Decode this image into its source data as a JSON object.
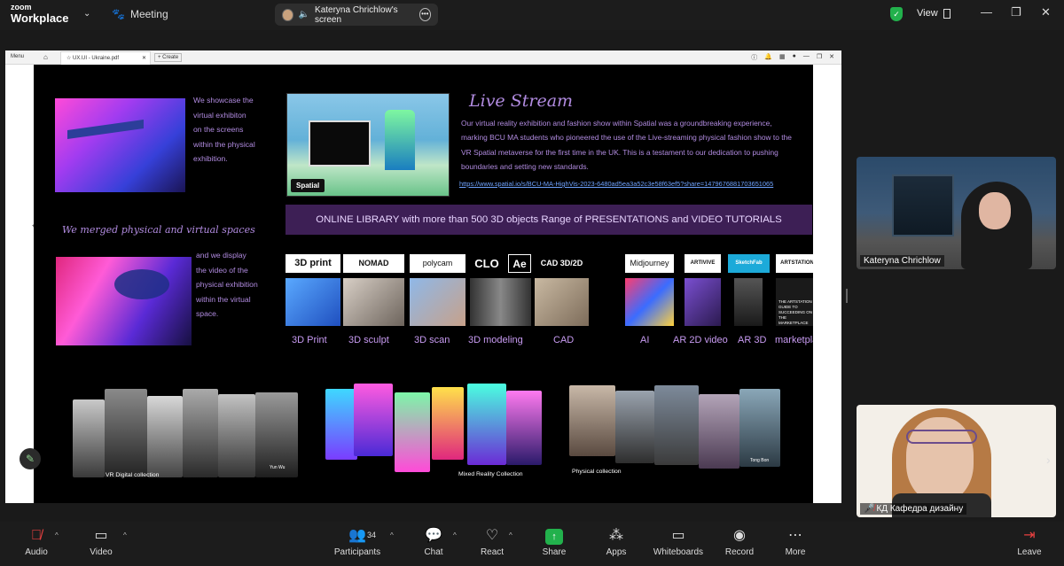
{
  "app": {
    "brand_top": "zoom",
    "brand_name": "Workplace",
    "meeting_label": "Meeting",
    "view_label": "View",
    "window_controls": [
      "—",
      "❐",
      "✕"
    ]
  },
  "screen_share": {
    "label": "Kateryna Chrichlow's screen"
  },
  "pdf_viewer": {
    "menu_label": "Menu",
    "tab_title": "UX.UI - Ukraine.pdf",
    "create_label": "+ Create"
  },
  "slide": {
    "showcase_text": "We showcase the virtual exhibiton on the screens within the physical exhibition.",
    "merged_title": "We merged physical and virtual spaces",
    "merged_text": "and we display the video of the physical exhibition within the virtual space.",
    "live_title": "Live Stream",
    "spatial_badge": "Spatial",
    "live_text": "Our virtual reality exhibition and fashion show within Spatial was a groundbreaking experience, marking BCU MA students who pioneered the use of the Live-streaming physical fashion show to the VR Spatial metaverse for the first time in the UK. This is a testament to our dedication to pushing boundaries and setting new standards.",
    "live_link": "https://www.spatial.io/s/BCU-MA-HighVis-2023-6480ad5ea3a52c3e58f63ef5?share=1479676881703651065",
    "library_banner": "ONLINE LIBRARY with more than 500 3D objects Range of PRESENTATIONS and VIDEO TUTORIALS",
    "logos": [
      "3D print",
      "NOMAD",
      "polycam",
      "CLO",
      "Ae",
      "CAD 3D/2D",
      "Midjourney",
      "ARTIVIVE",
      "SketchFab",
      "ARTSTATION"
    ],
    "tool_labels": [
      "3D Print",
      "3D sculpt",
      "3D scan",
      "3D modeling",
      "CAD",
      "AI",
      "AR 2D video",
      "AR 3D",
      "marketplace"
    ],
    "marketplace_thumb": "THE ARTSTATION GUIDE TO SUCCEEDING ON THE MARKETPLACE",
    "collections": [
      "VR Digital collection",
      "Mixed Reality Collection",
      "Physical collection"
    ],
    "figure_names": [
      "Yun Wu",
      "Tong Bon"
    ]
  },
  "participants": [
    {
      "name": "Kateryna Chrichlow",
      "muted": false
    },
    {
      "name": "КД Кафедра дизайну",
      "muted": true
    }
  ],
  "toolbar": {
    "audio": "Audio",
    "video": "Video",
    "participants": "Participants",
    "participants_count": "34",
    "chat": "Chat",
    "react": "React",
    "share": "Share",
    "apps": "Apps",
    "whiteboards": "Whiteboards",
    "record": "Record",
    "more": "More",
    "leave": "Leave"
  },
  "colors": {
    "accent_violet": "#b18be0",
    "banner_bg": "#3d1f55",
    "link_blue": "#6fa3ff",
    "share_green": "#22b14c",
    "shield_green": "#22b14c"
  }
}
